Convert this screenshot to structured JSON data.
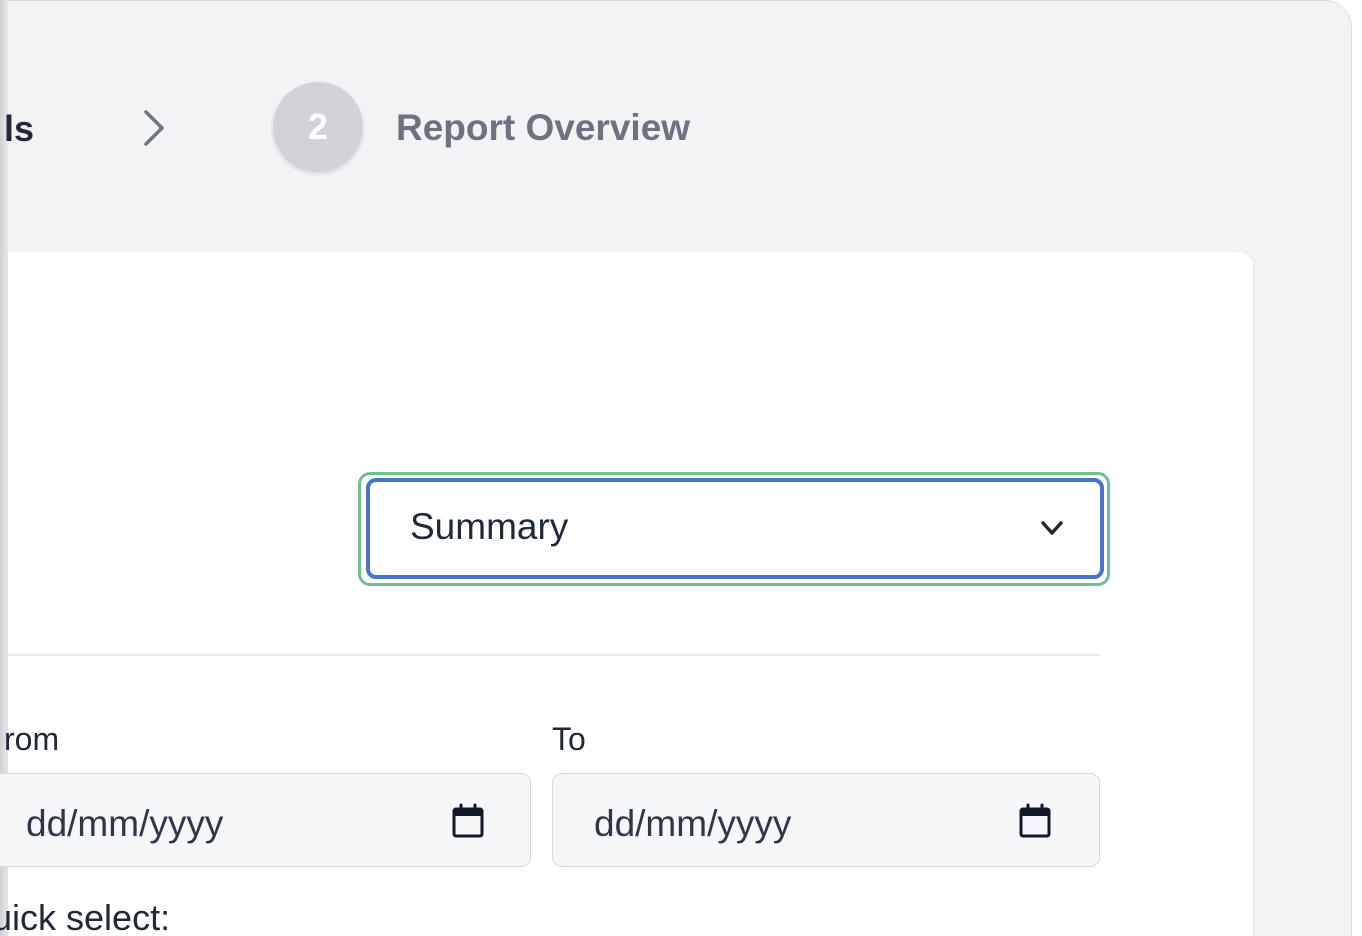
{
  "stepper": {
    "previous_step_label": "ls",
    "current_step_number": "2",
    "current_step_label": "Report Overview"
  },
  "report_type_select": {
    "selected_value": "Summary"
  },
  "date_range": {
    "from_label": "rom",
    "from_placeholder": "dd/mm/yyyy",
    "to_label": "To",
    "to_placeholder": "dd/mm/yyyy"
  },
  "quick_select": {
    "label": "uick select:"
  },
  "colors": {
    "focus_ring": "#6fbf8f",
    "select_border": "#4a74c9",
    "step_inactive": "#d1d3d8"
  }
}
